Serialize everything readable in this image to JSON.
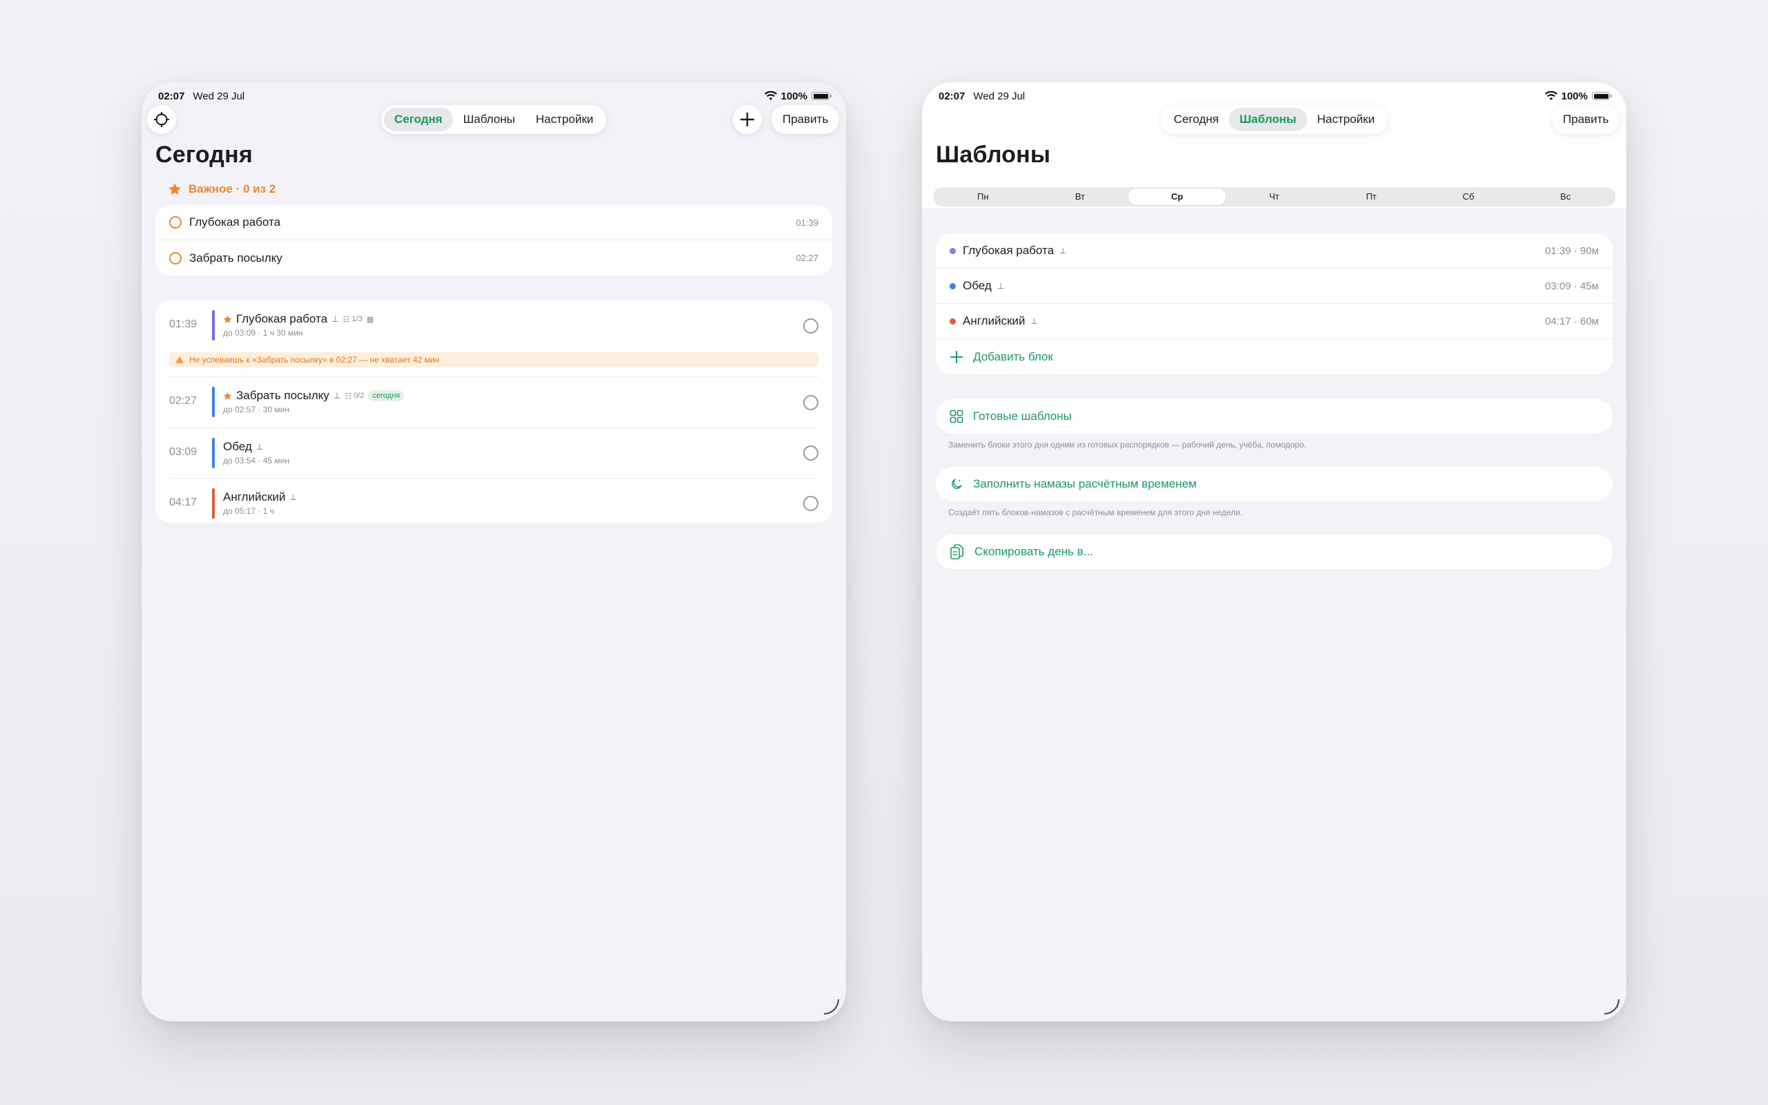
{
  "colors": {
    "accent": "#1a9a5e",
    "orange": "#f0862a",
    "purple": "#7b68ee",
    "blue": "#3b82e0",
    "red": "#e05a3b"
  },
  "status": {
    "time": "02:07",
    "date": "Wed 29 Jul",
    "battery": "100%"
  },
  "tabs": {
    "today": "Сегодня",
    "templates": "Шаблоны",
    "settings": "Настройки"
  },
  "edit_label": "Править",
  "left": {
    "title": "Сегодня",
    "important": {
      "header": "Важное · 0 из 2",
      "items": [
        {
          "name": "Глубокая работа",
          "time": "01:39"
        },
        {
          "name": "Забрать посылку",
          "time": "02:27"
        }
      ]
    },
    "schedule": [
      {
        "time": "01:39",
        "name": "Глубокая работа",
        "meta": "1/3",
        "sub": "до 03:09 · 1 ч 30 мин",
        "color": "#7b68ee"
      },
      {
        "time": "02:27",
        "name": "Забрать посылку",
        "meta": "0/2",
        "tag": "сегодня",
        "sub": "до 02:57 · 30 мин",
        "color": "#3b82e0"
      },
      {
        "time": "03:09",
        "name": "Обед",
        "sub": "до 03:54 · 45 мин",
        "color": "#3b82e0"
      },
      {
        "time": "04:17",
        "name": "Английский",
        "sub": "до 05:17 · 1 ч",
        "color": "#e05a3b"
      }
    ],
    "warning": "Не успеваешь к «Забрать посылку» в 02:27 — не хватает 42 мин"
  },
  "right": {
    "title": "Шаблоны",
    "days": [
      "Пн",
      "Вт",
      "Ср",
      "Чт",
      "Пт",
      "Сб",
      "Вс"
    ],
    "active_day": "Ср",
    "blocks": [
      {
        "name": "Глубокая работа",
        "right": "01:39 · 90м",
        "color": "#8e7be0"
      },
      {
        "name": "Обед",
        "right": "03:09 · 45м",
        "color": "#3b82e0"
      },
      {
        "name": "Английский",
        "right": "04:17 · 60м",
        "color": "#e05a3b"
      }
    ],
    "add_block": "Добавить блок",
    "ready_templates": "Готовые шаблоны",
    "ready_note": "Заменить блоки этого дня одним из готовых распорядков — рабочий день, учёба, помодоро.",
    "namaz": "Заполнить намазы расчётным временем",
    "namaz_note": "Создаёт пять блоков-намазов с расчётным временем для этого дня недели.",
    "copy_day": "Скопировать день в..."
  }
}
